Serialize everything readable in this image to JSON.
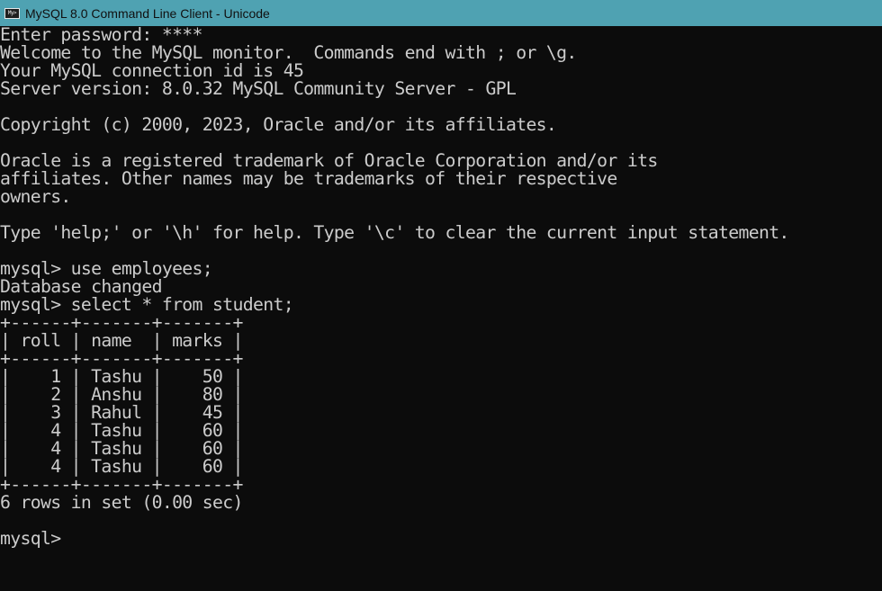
{
  "window": {
    "title": "MySQL 8.0 Command Line Client - Unicode",
    "icon": "mysql-console-icon",
    "icon_text": "My>"
  },
  "console": {
    "lines": [
      "Enter password: ****",
      "Welcome to the MySQL monitor.  Commands end with ; or \\g.",
      "Your MySQL connection id is 45",
      "Server version: 8.0.32 MySQL Community Server - GPL",
      "",
      "Copyright (c) 2000, 2023, Oracle and/or its affiliates.",
      "",
      "Oracle is a registered trademark of Oracle Corporation and/or its",
      "affiliates. Other names may be trademarks of their respective",
      "owners.",
      "",
      "Type 'help;' or '\\h' for help. Type '\\c' to clear the current input statement.",
      "",
      "mysql> use employees;",
      "Database changed",
      "mysql> select * from student;",
      "+------+-------+-------+",
      "| roll | name  | marks |",
      "+------+-------+-------+",
      "|    1 | Tashu |    50 |",
      "|    2 | Anshu |    80 |",
      "|    3 | Rahul |    45 |",
      "|    4 | Tashu |    60 |",
      "|    4 | Tashu |    60 |",
      "|    4 | Tashu |    60 |",
      "+------+-------+-------+",
      "6 rows in set (0.00 sec)",
      ""
    ],
    "prompt": "mysql>"
  },
  "colors": {
    "titlebar": "#4fa2b2",
    "console_background": "#0c0c0c",
    "console_text": "#cccccc"
  }
}
